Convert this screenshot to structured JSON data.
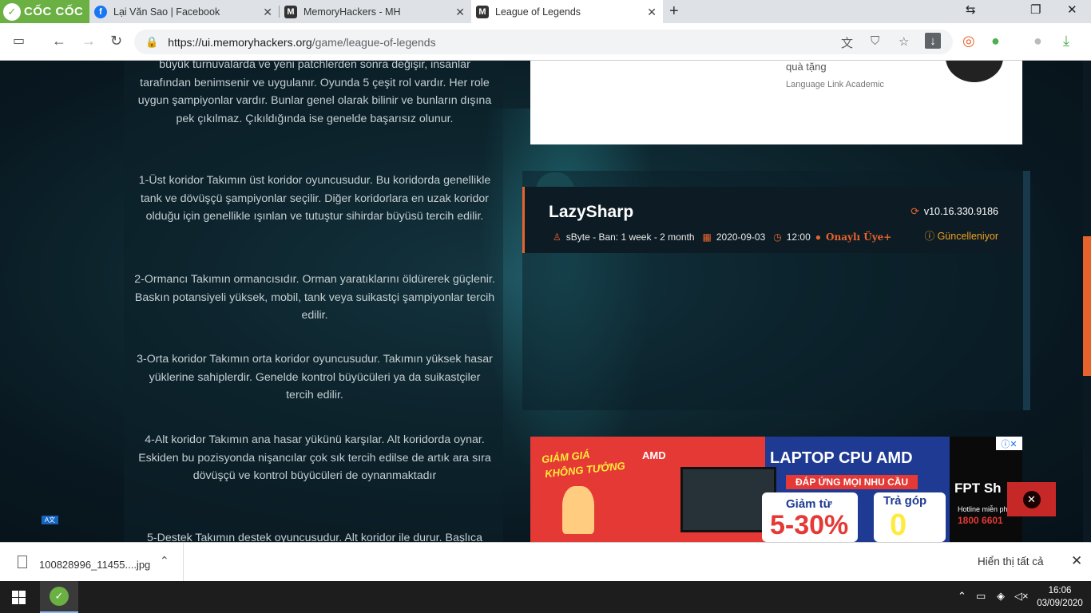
{
  "browser": {
    "brand": "CỐC CỐC",
    "tabs": [
      {
        "title": "Lại Văn Sao | Facebook",
        "icon": "facebook-icon"
      },
      {
        "title": "MemoryHackers - MH",
        "icon": "memoryhackers-icon"
      },
      {
        "title": "League of Legends",
        "icon": "memoryhackers-icon",
        "active": true
      }
    ],
    "url_host": "https://ui.memoryhackers.org",
    "url_path": "/game/league-of-legends"
  },
  "article": {
    "paragraphs": [
      "büyük turnuvalarda ve yeni patchlerden sonra değişir, insanlar tarafından benimsenir ve uygulanır. Oyunda 5 çeşit rol vardır. Her role uygun şampiyonlar vardır. Bunlar genel olarak bilinir ve bunların dışına pek çıkılmaz. Çıkıldığında ise genelde başarısız olunur.",
      "1-Üst koridor Takımın üst koridor oyuncusudur. Bu koridorda genellikle tank ve dövüşçü şampiyonlar seçilir. Diğer koridorlara en uzak koridor olduğu için genellikle ışınlan ve tutuştur sihirdar büyüsü tercih edilir.",
      "2-Ormancı Takımın ormancısıdır. Orman yaratıklarını öldürerek güçlenir. Baskın potansiyeli yüksek, mobil, tank veya suikastçi şampiyonlar tercih edilir.",
      "3-Orta koridor Takımın orta koridor oyuncusudur. Takımın yüksek hasar yüklerine sahiplerdir. Genelde kontrol büyücüleri ya da suikastçiler tercih edilir.",
      "4-Alt koridor Takımın ana hasar yükünü karşılar. Alt koridorda oynar. Eskiden bu pozisyonda nişancılar çok sık tercih edilse de artık ara sıra dövüşçü ve kontrol büyücüleri de oynanmaktadır",
      "5-Destek Takımın destek oyuncusudur. Alt koridor ile durur. Başlıca"
    ]
  },
  "top_ad": {
    "line1": "quà tặng",
    "line2": "Language Link Academic"
  },
  "cheat": {
    "title": "LazySharp",
    "author_ban": "sByte - Ban: 1 week - 2 month",
    "date": "2020-09-03",
    "time": "12:00",
    "verified": "Onaylı Üye+",
    "version": "v10.16.330.9186",
    "status": "Güncelleniyor"
  },
  "bottom_ad": {
    "promo1": "GIẢM GIÁ",
    "promo2": "KHÔNG TƯỞNG",
    "brand_amd": "AMD",
    "headline": "LAPTOP CPU AMD",
    "subline": "ĐÁP ỨNG MỌI NHU CẦU",
    "discount_label": "Giảm từ",
    "discount_value": "5-30%",
    "installment_label": "Trả góp",
    "installment_value": "0",
    "fpt": "FPT Sh",
    "hotline_label": "Hotline miễn ph",
    "hotline_number": "1800 6601"
  },
  "downloads": {
    "file": "100828996_11455....jpg",
    "show_all": "Hiển thị tất cả"
  },
  "taskbar": {
    "time": "16:06",
    "date": "03/09/2020"
  },
  "colors": {
    "accent": "#e8632b",
    "brand": "#6ab042"
  }
}
